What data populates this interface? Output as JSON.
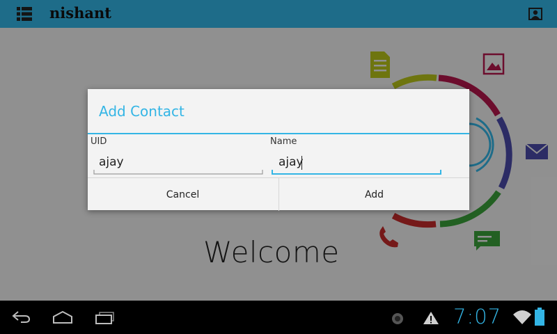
{
  "action_bar": {
    "title": "nishant",
    "menu_icon": "grid-menu-icon",
    "profile_icon": "contact-card-icon",
    "background_color": "#33b5e5"
  },
  "main": {
    "welcome_text": "Welcome",
    "graphic_icons": [
      "document-icon",
      "image-icon",
      "mail-icon",
      "message-icon",
      "phone-icon",
      "wifi-signal-icon"
    ]
  },
  "dialog": {
    "title": "Add Contact",
    "accent_color": "#33b5e5",
    "fields": [
      {
        "label": "UID",
        "value": "ajay"
      },
      {
        "label": "Name",
        "value": "ajay"
      }
    ],
    "buttons": {
      "cancel": "Cancel",
      "add": "Add"
    }
  },
  "system_bar": {
    "time": "7:07",
    "nav_icons": [
      "back-icon",
      "home-icon",
      "recent-apps-icon"
    ],
    "status_icons": [
      "notification-icon",
      "warning-icon",
      "wifi-icon",
      "battery-icon"
    ]
  }
}
